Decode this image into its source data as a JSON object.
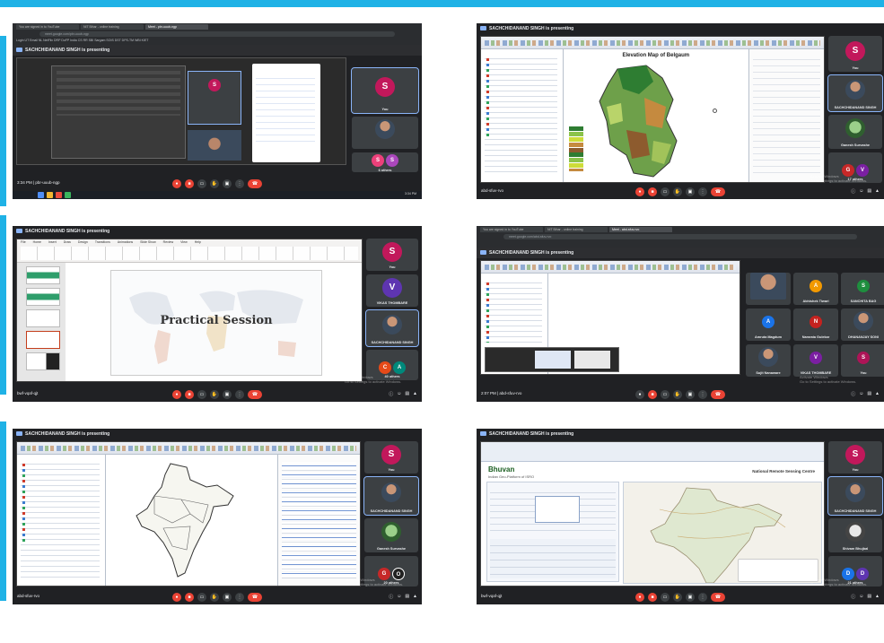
{
  "colors": {
    "accent": "#1fb2e6",
    "meet_bg": "#202124",
    "tile_bg": "#3c4043",
    "end_call": "#ea4335"
  },
  "icons": [
    "microphone-icon",
    "camera-icon",
    "captions-icon",
    "raise-hand-icon",
    "present-icon",
    "more-icon",
    "end-call-icon",
    "info-icon",
    "people-icon",
    "chat-icon",
    "activities-icon"
  ],
  "shots": {
    "s1": {
      "banner": "SACHCHIDANAND SINGH is presenting",
      "tabs": [
        "You are signed in to YouTube",
        "NIT Bihar - online training",
        "Meet - pbr-uuub-ngp"
      ],
      "url": "meet.google.com/pbr-uuub-ngp",
      "bookmarks": "Login  UT Email  NL  NetFlix  DRP  DoFP  India  CS  RR  SBI  Sargam  SOIS  DST  DPS-TM  WBI  KIET",
      "you_label": "You",
      "you_initial": "S",
      "others_initials": [
        "S",
        "S"
      ],
      "others_label": "6 others",
      "clock": "3:34 PM  |  pbr-uuub-ngp",
      "taskbar_time": "3:34 PM"
    },
    "s2": {
      "banner": "SACHCHIDANAND SINGH is presenting",
      "map_title": "Elevation Map of Belgaum",
      "you_label": "You",
      "you_initial": "S",
      "presenter_name": "SACHCHIDANAND SINGH",
      "p3_name": "Ganesh Survashe",
      "others_initials": [
        "G",
        "V"
      ],
      "others_label": "17 others",
      "clock": "abd-sfuv-rvo",
      "watermark_1": "Activate Windows",
      "watermark_2": "Go to Settings to activate Windows."
    },
    "s3": {
      "banner": "SACHCHIDANAND SINGH is presenting",
      "slide_title": "Practical Session",
      "ribbon_tabs": [
        "File",
        "Home",
        "Insert",
        "Draw",
        "Design",
        "Transitions",
        "Animations",
        "Slide Show",
        "Review",
        "View",
        "Help"
      ],
      "you_label": "You",
      "you_initial": "S",
      "p2_initial": "V",
      "p2_name": "VIKAS THOMBARE",
      "presenter_name": "SACHCHIDANAND SINGH",
      "others_initials": [
        "C",
        "A"
      ],
      "others_label": "40 others",
      "clock": "bwf-vqaf-qjt",
      "watermark_1": "Activate Windows",
      "watermark_2": "Go to Settings to activate Windows."
    },
    "s4": {
      "banner": "SACHCHIDANAND SINGH is presenting",
      "tabs": [
        "You are signed in to YouTube",
        "NIT Bihar - online training",
        "Meet - abd-sfuv-rvo"
      ],
      "url": "meet.google.com/abd-sfuv-rvo",
      "grid": [
        {
          "initial": "",
          "name": "",
          "color": "",
          "photo": true
        },
        {
          "initial": "A",
          "name": "Abhishek Tiwari",
          "color": "#f29900",
          "photo": false
        },
        {
          "initial": "S",
          "name": "SANCHITA BAG",
          "color": "#1e8e3e",
          "photo": false
        },
        {
          "initial": "A",
          "name": "Amruta Magdum",
          "color": "#1a73e8",
          "photo": false
        },
        {
          "initial": "N",
          "name": "Namrata Gulekar",
          "color": "#c5221f",
          "photo": false
        },
        {
          "initial": "",
          "name": "DHANANJAY SONI",
          "color": "",
          "photo": true
        },
        {
          "initial": "",
          "name": "Sujit Nanaware",
          "color": "",
          "photo": true
        },
        {
          "initial": "V",
          "name": "VIKAS THOMBARE",
          "color": "#7b1fa2",
          "photo": false
        },
        {
          "initial": "S",
          "name": "You",
          "color": "#ad1457",
          "photo": false
        }
      ],
      "clock": "2:07 PM  |  abd-sfuv-rvo",
      "watermark_1": "Activate Windows",
      "watermark_2": "Go to Settings to activate Windows."
    },
    "s5": {
      "banner": "SACHCHIDANAND SINGH is presenting",
      "you_label": "You",
      "you_initial": "S",
      "presenter_name": "SACHCHIDANAND SINGH",
      "p3_name": "Ganesh Survashe",
      "others_initials": [
        "G",
        "O"
      ],
      "others_label": "20 others",
      "clock": "abd-sfuv-rvo",
      "watermark_1": "Activate Windows",
      "watermark_2": "Go to Settings to activate Windows."
    },
    "s6": {
      "banner": "SACHCHIDANAND SINGH is presenting",
      "site_name": "Bhuvan",
      "site_sub": "Indian Geo-Platform of ISRO",
      "site_right": "National Remote Sensing Centre",
      "you_label": "You",
      "you_initial": "S",
      "presenter_name": "SACHCHIDANAND SINGH",
      "p3_name": "Shivam Bhujbal",
      "others_initials": [
        "D",
        "D"
      ],
      "others_label": "21 others",
      "clock": "bwf-vqaf-qjt",
      "watermark_1": "Activate Windows",
      "watermark_2": "Go to Settings to activate Windows."
    }
  }
}
